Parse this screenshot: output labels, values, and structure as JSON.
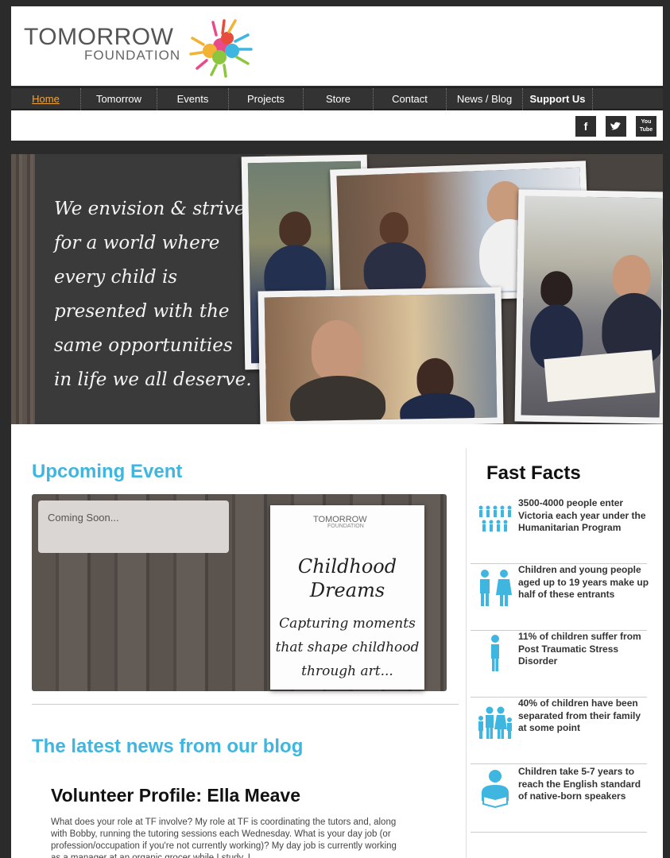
{
  "logo": {
    "title": "TOMORROW",
    "subtitle": "FOUNDATION"
  },
  "nav": {
    "items": [
      {
        "label": "Home"
      },
      {
        "label": "Tomorrow"
      },
      {
        "label": "Events"
      },
      {
        "label": "Projects"
      },
      {
        "label": "Store"
      },
      {
        "label": "Contact"
      },
      {
        "label": "News / Blog"
      },
      {
        "label": "Support Us"
      }
    ]
  },
  "social": {
    "facebook": "f",
    "twitter": "t",
    "youtube": "You Tube"
  },
  "hero": {
    "quote": "We envision & strive for a world where every child is presented with the same opportunities in life we all deserve."
  },
  "event": {
    "heading": "Upcoming Event",
    "status": "Coming Soon...",
    "card_logo": "TOMORROW",
    "card_logo_sub": "FOUNDATION",
    "card_title": "Childhood Dreams",
    "card_subtitle": "Capturing moments that shape childhood through art..."
  },
  "blog": {
    "heading": "The latest news from our blog",
    "post_title": "Volunteer Profile: Ella Meave",
    "post_excerpt": "What does your role at TF involve? My role at TF is coordinating the tutors and, along with Bobby, running the tutoring sessions each Wednesday. What is your day job (or profession/occupation if you're not currently working)? My day job is currently working as a manager at an organic grocer while I study. I"
  },
  "facts": {
    "heading": "Fast Facts",
    "items": [
      {
        "text": "3500-4000 people enter Victoria each year under the Humanitarian Program",
        "icon": "people-group-icon"
      },
      {
        "text": "Children and young people aged up to 19 years make up half of these entrants",
        "icon": "boy-girl-icon"
      },
      {
        "text": "11% of children suffer from Post Traumatic Stress Disorder",
        "icon": "single-person-icon"
      },
      {
        "text": "40% of children have been separated from their family at some point",
        "icon": "family-icon"
      },
      {
        "text": "Children take 5-7 years to reach the English standard of native-born speakers",
        "icon": "reading-person-icon"
      }
    ]
  },
  "colors": {
    "accent": "#3fb6e0",
    "nav_active": "#f0a43a",
    "nav_bg": "#333333",
    "page_bg": "#2b2b2b"
  }
}
